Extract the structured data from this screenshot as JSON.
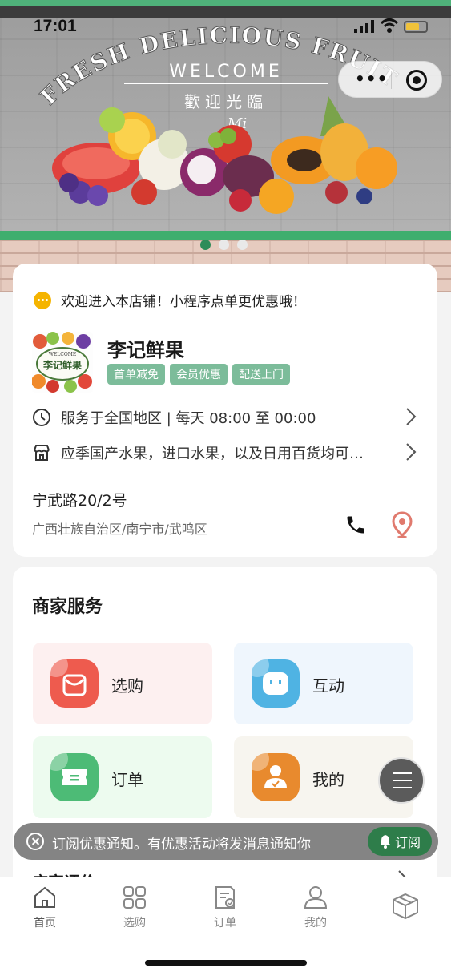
{
  "status": {
    "time": "17:01"
  },
  "banner": {
    "arc_text": "FRESH DELICIOUS FRUIT",
    "welcome": "WELCOME",
    "chinese": "歡迎光臨",
    "script": "Mi",
    "indicator_count": 3,
    "active_index": 0
  },
  "store": {
    "notice": "欢迎进入本店铺！小程序点单更优惠哦！",
    "logo_top": "WELCOME",
    "logo_text": "李记鲜果",
    "name": "李记鲜果",
    "tags": [
      "首单减免",
      "会员优惠",
      "配送上门"
    ],
    "hours": "服务于全国地区 | 每天 08:00 至 00:00",
    "description": "应季国产水果，进口水果，以及日用百货均可…",
    "address_line": "宁武路20/2号",
    "region": "广西壮族自治区/南宁市/武鸣区"
  },
  "services": {
    "title": "商家服务",
    "items": [
      {
        "label": "选购",
        "icon": "shopping-bag-icon",
        "bg": "#fdf0f0",
        "color": "#ee5b4e"
      },
      {
        "label": "互动",
        "icon": "chat-face-icon",
        "bg": "#eff6fd",
        "color": "#4fb3e3"
      },
      {
        "label": "订单",
        "icon": "ticket-icon",
        "bg": "#edfbef",
        "color": "#4dbb76"
      },
      {
        "label": "我的",
        "icon": "user-icon",
        "bg": "#f7f5ef",
        "color": "#e88a2e"
      }
    ],
    "reviews_title": "店家评价"
  },
  "subscribe": {
    "text": "订阅优惠通知。有优惠活动将发消息通知你",
    "button": "订阅"
  },
  "tabbar": [
    {
      "label": "首页",
      "icon": "home-icon",
      "active": true
    },
    {
      "label": "选购",
      "icon": "grid-icon",
      "active": false
    },
    {
      "label": "订单",
      "icon": "order-icon",
      "active": false
    },
    {
      "label": "我的",
      "icon": "profile-icon",
      "active": false
    },
    {
      "label": "",
      "icon": "box-icon",
      "active": false
    }
  ],
  "colors": {
    "brand_green": "#3fae6e",
    "tag_green": "#7cbc9a",
    "accent_pin": "#e07a6e"
  }
}
